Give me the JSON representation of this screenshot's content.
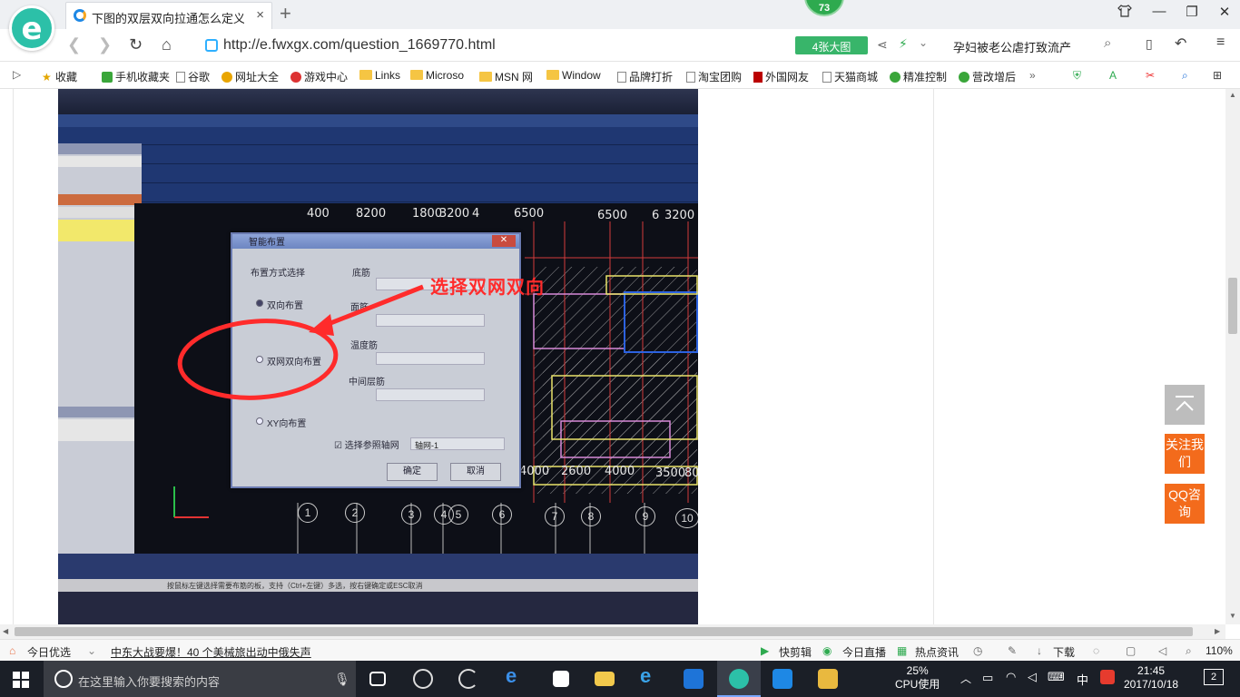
{
  "browser": {
    "tab_title": "下图的双层双向拉通怎么定义？还",
    "badge_count": "73",
    "url": "http://e.fwxgx.com/question_1669770.html",
    "big_image_button": "4张大图",
    "search_suggestion": "孕妇被老公虐打致流产"
  },
  "bookmarks": [
    {
      "label": "收藏",
      "icon": "star-icon"
    },
    {
      "label": "手机收藏夹",
      "icon": "phone-icon"
    },
    {
      "label": "谷歌",
      "icon": "page-icon"
    },
    {
      "label": "网址大全",
      "icon": "globe-icon"
    },
    {
      "label": "游戏中心",
      "icon": "game-icon"
    },
    {
      "label": "Links",
      "icon": "folder-icon"
    },
    {
      "label": "Microso",
      "icon": "folder-icon"
    },
    {
      "label": "MSN 网",
      "icon": "folder-icon"
    },
    {
      "label": "Window",
      "icon": "folder-icon"
    },
    {
      "label": "品牌打折",
      "icon": "page-icon"
    },
    {
      "label": "淘宝团购",
      "icon": "page-icon"
    },
    {
      "label": "外国网友",
      "icon": "flag-icon"
    },
    {
      "label": "天猫商城",
      "icon": "page-icon"
    },
    {
      "label": "精准控制",
      "icon": "wechat-icon"
    },
    {
      "label": "营改增后",
      "icon": "wechat-icon"
    }
  ],
  "photo": {
    "annotation": "选择双网双向",
    "dialog": {
      "title": "智能布置",
      "group_label": "布置方式选择",
      "radio_1": "双向布置",
      "radio_2": "双网双向布置",
      "radio_3": "XY向布置",
      "field_1": "底筋",
      "field_2": "面筋",
      "field_3": "温度筋",
      "field_4": "中间层筋",
      "checkbox": "选择参照轴网",
      "axis_select": "轴网-1",
      "ok": "确定",
      "cancel": "取消"
    },
    "dim_top": [
      "400",
      "8200",
      "1800",
      "3200",
      "4",
      "6500",
      "6500",
      "6",
      "3200"
    ],
    "dim_bottom": [
      "4000",
      "2600",
      "4000",
      "3500",
      "80"
    ],
    "axis_numbers": [
      "1",
      "2",
      "3",
      "4",
      "5",
      "6",
      "7",
      "8",
      "9",
      "10"
    ],
    "status_line": "按鼠标左键选择需要布筋的板，支持（Ctrl+左键）多选，按右键确定或ESC取消"
  },
  "side_widgets": {
    "follow": "关注我们",
    "qq": "QQ咨询"
  },
  "statusbar": {
    "today": "今日优选",
    "news": "中东大战要爆！40 个美械旅出动中俄失声",
    "items": [
      "快剪辑",
      "今日直播",
      "热点资讯",
      "下载"
    ],
    "zoom": "110%"
  },
  "taskbar": {
    "search_placeholder": "在这里输入你要搜索的内容",
    "cpu_percent": "25%",
    "cpu_label": "CPU使用",
    "ime": "中",
    "time": "21:45",
    "date": "2017/10/18",
    "notification_count": "2"
  },
  "colors": {
    "accent_green": "#2eaa4f",
    "orange_widget": "#f36b1c",
    "annotation_red": "#ff2b2b"
  }
}
